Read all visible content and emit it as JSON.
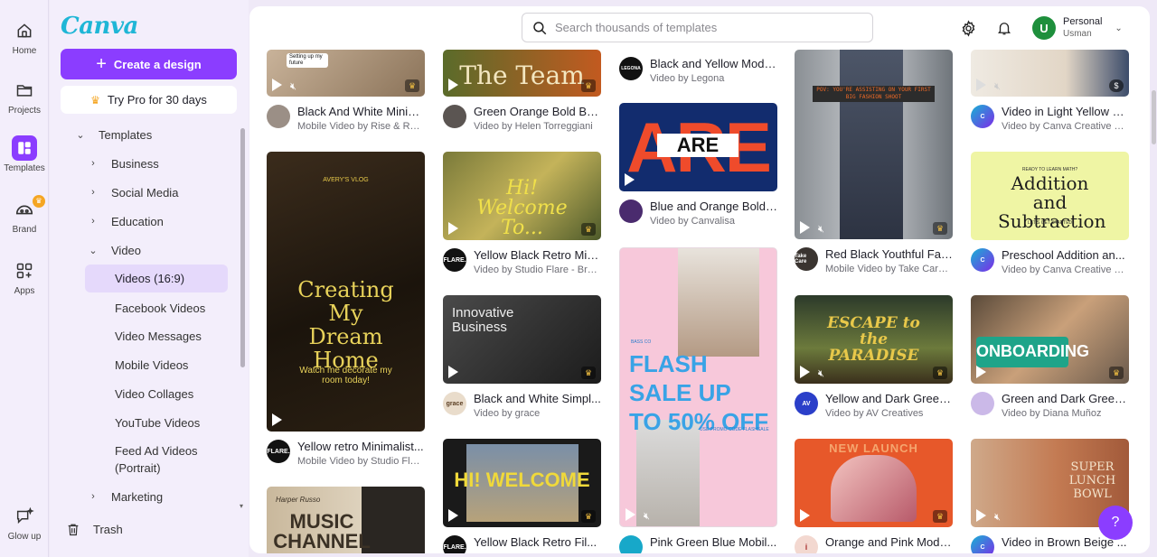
{
  "rail": {
    "items": [
      {
        "label": "Home",
        "icon": "home-icon"
      },
      {
        "label": "Projects",
        "icon": "folder-icon"
      },
      {
        "label": "Templates",
        "icon": "templates-icon"
      },
      {
        "label": "Brand",
        "icon": "brand-icon"
      },
      {
        "label": "Apps",
        "icon": "apps-icon"
      },
      {
        "label": "Glow up",
        "icon": "glow-up-icon"
      }
    ]
  },
  "panel": {
    "logo": "Canva",
    "create_label": "Create a design",
    "pro_label": "Try Pro for 30 days",
    "tree": [
      {
        "label": "Templates"
      },
      {
        "label": "Business"
      },
      {
        "label": "Social Media"
      },
      {
        "label": "Education"
      },
      {
        "label": "Video"
      },
      {
        "label": "Videos (16:9)"
      },
      {
        "label": "Facebook Videos"
      },
      {
        "label": "Video Messages"
      },
      {
        "label": "Mobile Videos"
      },
      {
        "label": "Video Collages"
      },
      {
        "label": "YouTube Videos"
      },
      {
        "label": "Feed Ad Videos"
      },
      {
        "label": "(Portrait)"
      },
      {
        "label": "Marketing"
      }
    ],
    "trash_label": "Trash"
  },
  "header": {
    "search_placeholder": "Search thousands of templates",
    "account_name": "Personal",
    "account_user": "Usman",
    "avatar_letter": "U"
  },
  "cards": [
    {
      "title": "Black And White Minim...",
      "sub": "Mobile Video by Rise & Roa...",
      "thumb_text": "Setting up my future"
    },
    {
      "title": "Green Orange Bold Bu...",
      "sub": "Video by Helen Torreggiani",
      "thumb_text": "The Team"
    },
    {
      "title": "Black and Yellow Mode...",
      "sub": "Video by Legona",
      "thumb_text": "LEGONA"
    },
    {
      "title": "Video in Light Yellow B...",
      "sub": "Video by Canva Creative St...",
      "thumb_text": ""
    },
    {
      "title": "Yellow retro Minimalist...",
      "sub": "Mobile Video by Studio Flar...",
      "thumb_text": "Creating My Dream Home",
      "thumb_top": "AVERY'S VLOG",
      "thumb_bottom": "Watch me decorate my room today!"
    },
    {
      "title": "Yellow Black Retro Min...",
      "sub": "Video by Studio Flare - Bra...",
      "thumb_text": "Hi! Welcome To..."
    },
    {
      "title": "Blue and Orange Bold ...",
      "sub": "Video by Canvalisa",
      "thumb_text": "ARE"
    },
    {
      "title": "Red Black Youthful Fas...",
      "sub": "Mobile Video by Take Care ...",
      "thumb_text": "POV: YOU'RE ASSISTING ON YOUR FIRST BIG FASHION SHOOT"
    },
    {
      "title": "Preschool Addition an...",
      "sub": "Video by Canva Creative St...",
      "thumb_text": "Addition and Subtraction",
      "thumb_top": "READY TO LEARN MATH?",
      "thumb_bottom": "LET'S GET STARTED"
    },
    {
      "title": "Black and White Simpl...",
      "sub": "Video by grace",
      "thumb_text": "Innovative Business"
    },
    {
      "title": "Pink Green Blue Mobil...",
      "sub": "",
      "thumb_text": "FLASH SALE UP TO 50% OFF",
      "thumb_top": "BASS CO",
      "thumb_bottom": "USE PROMO CODE FLASHSALE"
    },
    {
      "title": "Yellow and Dark Green ...",
      "sub": "Video by AV Creatives",
      "thumb_text": "ESCAPE to the PARADISE"
    },
    {
      "title": "Green and Dark Green ...",
      "sub": "Video by Diana Muñoz",
      "thumb_text": "ONBOARDING"
    },
    {
      "title": "Yellow Black Retro Fil...",
      "sub": "",
      "thumb_text": "HI! WELCOME"
    },
    {
      "title": "Orange and Pink Mode...",
      "sub": "",
      "thumb_text": "NEW LAUNCH"
    },
    {
      "title": "Video in Brown Beige ...",
      "sub": "",
      "thumb_text": "SUPER LUNCH BOWL"
    },
    {
      "title": "",
      "sub": "",
      "thumb_text": "MUSIC CHANNEL",
      "thumb_top": "Harper Russo"
    }
  ],
  "help_label": "?",
  "colors": {
    "accent": "#8b3dff",
    "logo": "#1fb6d6",
    "avatar": "#1e8f3c"
  }
}
